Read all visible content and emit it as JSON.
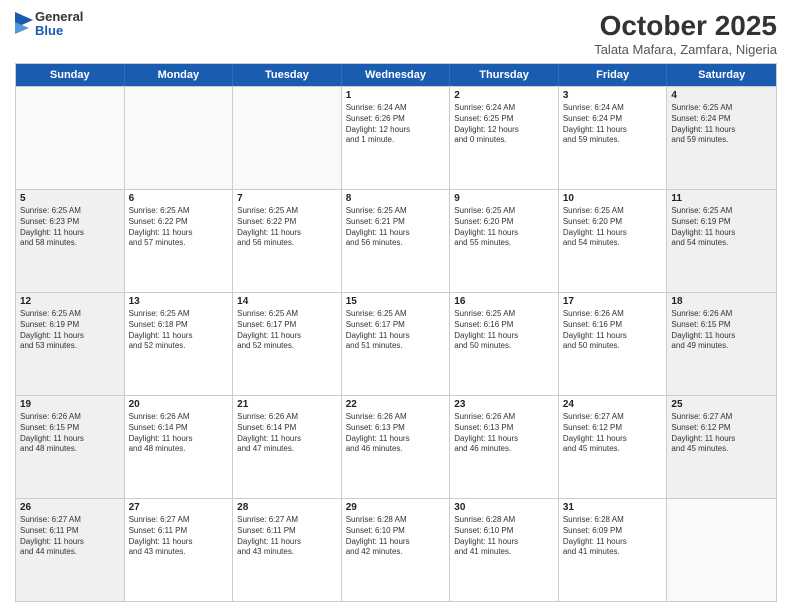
{
  "header": {
    "logo_line1": "General",
    "logo_line2": "Blue",
    "main_title": "October 2025",
    "subtitle": "Talata Mafara, Zamfara, Nigeria"
  },
  "weekdays": [
    "Sunday",
    "Monday",
    "Tuesday",
    "Wednesday",
    "Thursday",
    "Friday",
    "Saturday"
  ],
  "rows": [
    [
      {
        "day": "",
        "info": "",
        "empty": true
      },
      {
        "day": "",
        "info": "",
        "empty": true
      },
      {
        "day": "",
        "info": "",
        "empty": true
      },
      {
        "day": "1",
        "info": "Sunrise: 6:24 AM\nSunset: 6:26 PM\nDaylight: 12 hours\nand 1 minute."
      },
      {
        "day": "2",
        "info": "Sunrise: 6:24 AM\nSunset: 6:25 PM\nDaylight: 12 hours\nand 0 minutes."
      },
      {
        "day": "3",
        "info": "Sunrise: 6:24 AM\nSunset: 6:24 PM\nDaylight: 11 hours\nand 59 minutes."
      },
      {
        "day": "4",
        "info": "Sunrise: 6:25 AM\nSunset: 6:24 PM\nDaylight: 11 hours\nand 59 minutes."
      }
    ],
    [
      {
        "day": "5",
        "info": "Sunrise: 6:25 AM\nSunset: 6:23 PM\nDaylight: 11 hours\nand 58 minutes."
      },
      {
        "day": "6",
        "info": "Sunrise: 6:25 AM\nSunset: 6:22 PM\nDaylight: 11 hours\nand 57 minutes."
      },
      {
        "day": "7",
        "info": "Sunrise: 6:25 AM\nSunset: 6:22 PM\nDaylight: 11 hours\nand 56 minutes."
      },
      {
        "day": "8",
        "info": "Sunrise: 6:25 AM\nSunset: 6:21 PM\nDaylight: 11 hours\nand 56 minutes."
      },
      {
        "day": "9",
        "info": "Sunrise: 6:25 AM\nSunset: 6:20 PM\nDaylight: 11 hours\nand 55 minutes."
      },
      {
        "day": "10",
        "info": "Sunrise: 6:25 AM\nSunset: 6:20 PM\nDaylight: 11 hours\nand 54 minutes."
      },
      {
        "day": "11",
        "info": "Sunrise: 6:25 AM\nSunset: 6:19 PM\nDaylight: 11 hours\nand 54 minutes."
      }
    ],
    [
      {
        "day": "12",
        "info": "Sunrise: 6:25 AM\nSunset: 6:19 PM\nDaylight: 11 hours\nand 53 minutes."
      },
      {
        "day": "13",
        "info": "Sunrise: 6:25 AM\nSunset: 6:18 PM\nDaylight: 11 hours\nand 52 minutes."
      },
      {
        "day": "14",
        "info": "Sunrise: 6:25 AM\nSunset: 6:17 PM\nDaylight: 11 hours\nand 52 minutes."
      },
      {
        "day": "15",
        "info": "Sunrise: 6:25 AM\nSunset: 6:17 PM\nDaylight: 11 hours\nand 51 minutes."
      },
      {
        "day": "16",
        "info": "Sunrise: 6:25 AM\nSunset: 6:16 PM\nDaylight: 11 hours\nand 50 minutes."
      },
      {
        "day": "17",
        "info": "Sunrise: 6:26 AM\nSunset: 6:16 PM\nDaylight: 11 hours\nand 50 minutes."
      },
      {
        "day": "18",
        "info": "Sunrise: 6:26 AM\nSunset: 6:15 PM\nDaylight: 11 hours\nand 49 minutes."
      }
    ],
    [
      {
        "day": "19",
        "info": "Sunrise: 6:26 AM\nSunset: 6:15 PM\nDaylight: 11 hours\nand 48 minutes."
      },
      {
        "day": "20",
        "info": "Sunrise: 6:26 AM\nSunset: 6:14 PM\nDaylight: 11 hours\nand 48 minutes."
      },
      {
        "day": "21",
        "info": "Sunrise: 6:26 AM\nSunset: 6:14 PM\nDaylight: 11 hours\nand 47 minutes."
      },
      {
        "day": "22",
        "info": "Sunrise: 6:26 AM\nSunset: 6:13 PM\nDaylight: 11 hours\nand 46 minutes."
      },
      {
        "day": "23",
        "info": "Sunrise: 6:26 AM\nSunset: 6:13 PM\nDaylight: 11 hours\nand 46 minutes."
      },
      {
        "day": "24",
        "info": "Sunrise: 6:27 AM\nSunset: 6:12 PM\nDaylight: 11 hours\nand 45 minutes."
      },
      {
        "day": "25",
        "info": "Sunrise: 6:27 AM\nSunset: 6:12 PM\nDaylight: 11 hours\nand 45 minutes."
      }
    ],
    [
      {
        "day": "26",
        "info": "Sunrise: 6:27 AM\nSunset: 6:11 PM\nDaylight: 11 hours\nand 44 minutes."
      },
      {
        "day": "27",
        "info": "Sunrise: 6:27 AM\nSunset: 6:11 PM\nDaylight: 11 hours\nand 43 minutes."
      },
      {
        "day": "28",
        "info": "Sunrise: 6:27 AM\nSunset: 6:11 PM\nDaylight: 11 hours\nand 43 minutes."
      },
      {
        "day": "29",
        "info": "Sunrise: 6:28 AM\nSunset: 6:10 PM\nDaylight: 11 hours\nand 42 minutes."
      },
      {
        "day": "30",
        "info": "Sunrise: 6:28 AM\nSunset: 6:10 PM\nDaylight: 11 hours\nand 41 minutes."
      },
      {
        "day": "31",
        "info": "Sunrise: 6:28 AM\nSunset: 6:09 PM\nDaylight: 11 hours\nand 41 minutes."
      },
      {
        "day": "",
        "info": "",
        "empty": true
      }
    ]
  ]
}
